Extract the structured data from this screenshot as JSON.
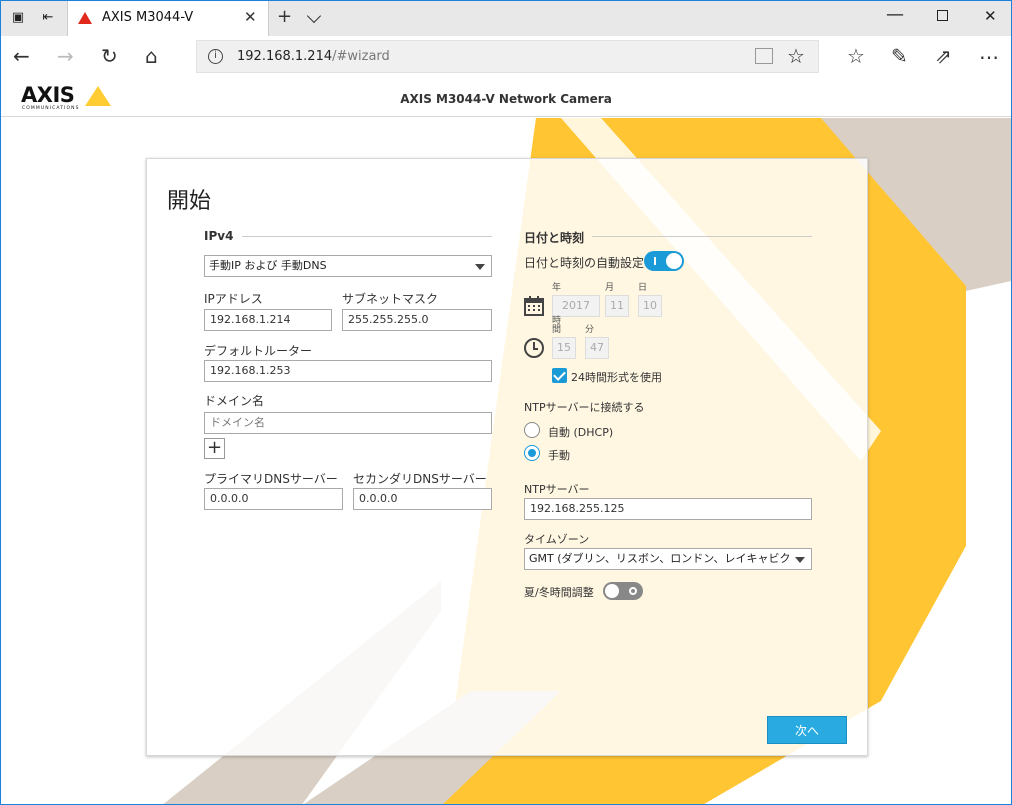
{
  "browser": {
    "tab_title": "AXIS M3044-V",
    "url_host": "192.168.1.214",
    "url_path": "/#wizard"
  },
  "app": {
    "logo_text": "AXIS",
    "logo_sub": "COMMUNICATIONS",
    "title": "AXIS M3044-V Network Camera"
  },
  "wizard": {
    "heading": "開始",
    "ipv4": {
      "section": "IPv4",
      "mode": "手動IP および 手動DNS",
      "ip_label": "IPアドレス",
      "ip_value": "192.168.1.214",
      "subnet_label": "サブネットマスク",
      "subnet_value": "255.255.255.0",
      "router_label": "デフォルトルーター",
      "router_value": "192.168.1.253",
      "domain_label": "ドメイン名",
      "domain_placeholder": "ドメイン名",
      "add_symbol": "+",
      "dns1_label": "プライマリDNSサーバー",
      "dns1_value": "0.0.0.0",
      "dns2_label": "セカンダリDNSサーバー",
      "dns2_value": "0.0.0.0"
    },
    "datetime": {
      "section": "日付と時刻",
      "auto_label": "日付と時刻の自動設定",
      "year_label": "年",
      "month_label": "月",
      "day_label": "日",
      "year": "2017",
      "month": "11",
      "day": "10",
      "hour_label": "時間",
      "minute_label": "分",
      "hour": "15",
      "minute": "47",
      "format24_label": "24時間形式を使用",
      "ntp_connect_label": "NTPサーバーに接続する",
      "radio_auto": "自動 (DHCP)",
      "radio_manual": "手動",
      "ntp_label": "NTPサーバー",
      "ntp_value": "192.168.255.125",
      "tz_label": "タイムゾーン",
      "tz_value": "GMT (ダブリン、リスボン、ロンドン、レイキャビク)",
      "dst_label": "夏/冬時間調整"
    },
    "next_button": "次へ"
  },
  "colors": {
    "accent": "#29abe2",
    "yellow": "#ffc533",
    "beige": "#d9cfc4"
  }
}
